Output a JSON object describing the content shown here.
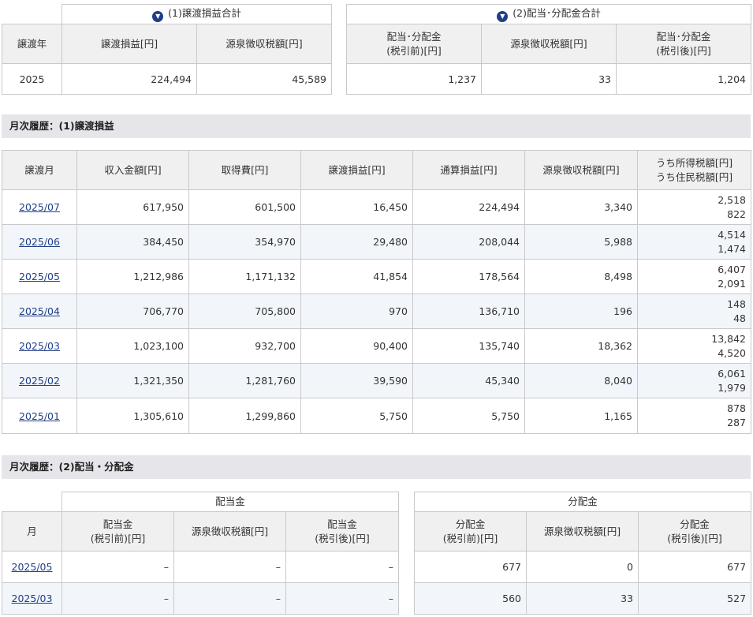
{
  "summary_left": {
    "group_title": "(1)譲渡損益合計",
    "headers": [
      "譲渡年",
      "譲渡損益[円]",
      "源泉徴収税額[円]"
    ],
    "row": {
      "year": "2025",
      "gain": "224,494",
      "tax": "45,589"
    }
  },
  "summary_right": {
    "group_title": "(2)配当･分配金合計",
    "headers": [
      "配当･分配金\n(税引前)[円]",
      "源泉徴収税額[円]",
      "配当･分配金\n(税引後)[円]"
    ],
    "row": {
      "pre": "1,237",
      "tax": "33",
      "post": "1,204"
    }
  },
  "monthly_gain": {
    "title": "月次履歴：(1)譲渡損益",
    "headers": [
      "譲渡月",
      "収入金額[円]",
      "取得費[円]",
      "譲渡損益[円]",
      "通算損益[円]",
      "源泉徴収税額[円]",
      "うち所得税額[円]\nうち住民税額[円]"
    ],
    "rows": [
      {
        "month": "2025/07",
        "income": "617,950",
        "cost": "601,500",
        "gain": "16,450",
        "total": "224,494",
        "tax": "3,340",
        "income_tax": "2,518",
        "resident_tax": "822"
      },
      {
        "month": "2025/06",
        "income": "384,450",
        "cost": "354,970",
        "gain": "29,480",
        "total": "208,044",
        "tax": "5,988",
        "income_tax": "4,514",
        "resident_tax": "1,474"
      },
      {
        "month": "2025/05",
        "income": "1,212,986",
        "cost": "1,171,132",
        "gain": "41,854",
        "total": "178,564",
        "tax": "8,498",
        "income_tax": "6,407",
        "resident_tax": "2,091"
      },
      {
        "month": "2025/04",
        "income": "706,770",
        "cost": "705,800",
        "gain": "970",
        "total": "136,710",
        "tax": "196",
        "income_tax": "148",
        "resident_tax": "48"
      },
      {
        "month": "2025/03",
        "income": "1,023,100",
        "cost": "932,700",
        "gain": "90,400",
        "total": "135,740",
        "tax": "18,362",
        "income_tax": "13,842",
        "resident_tax": "4,520"
      },
      {
        "month": "2025/02",
        "income": "1,321,350",
        "cost": "1,281,760",
        "gain": "39,590",
        "total": "45,340",
        "tax": "8,040",
        "income_tax": "6,061",
        "resident_tax": "1,979"
      },
      {
        "month": "2025/01",
        "income": "1,305,610",
        "cost": "1,299,860",
        "gain": "5,750",
        "total": "5,750",
        "tax": "1,165",
        "income_tax": "878",
        "resident_tax": "287"
      }
    ]
  },
  "monthly_dividend": {
    "title": "月次履歴：(2)配当・分配金",
    "left_group": "配当金",
    "right_group": "分配金",
    "month_header": "月",
    "left_headers": [
      "配当金\n(税引前)[円]",
      "源泉徴収税額[円]",
      "配当金\n(税引後)[円]"
    ],
    "right_headers": [
      "分配金\n(税引前)[円]",
      "源泉徴収税額[円]",
      "分配金\n(税引後)[円]"
    ],
    "rows": [
      {
        "month": "2025/05",
        "d_pre": "–",
        "d_tax": "–",
        "d_post": "–",
        "b_pre": "677",
        "b_tax": "0",
        "b_post": "677"
      },
      {
        "month": "2025/03",
        "d_pre": "–",
        "d_tax": "–",
        "d_post": "–",
        "b_pre": "560",
        "b_tax": "33",
        "b_post": "527"
      }
    ]
  },
  "colors": {
    "header_bg": "#f0f0f0",
    "section_bg": "#e6e6ea",
    "link": "#1f3e87",
    "alt_row": "#f2f6fb"
  }
}
